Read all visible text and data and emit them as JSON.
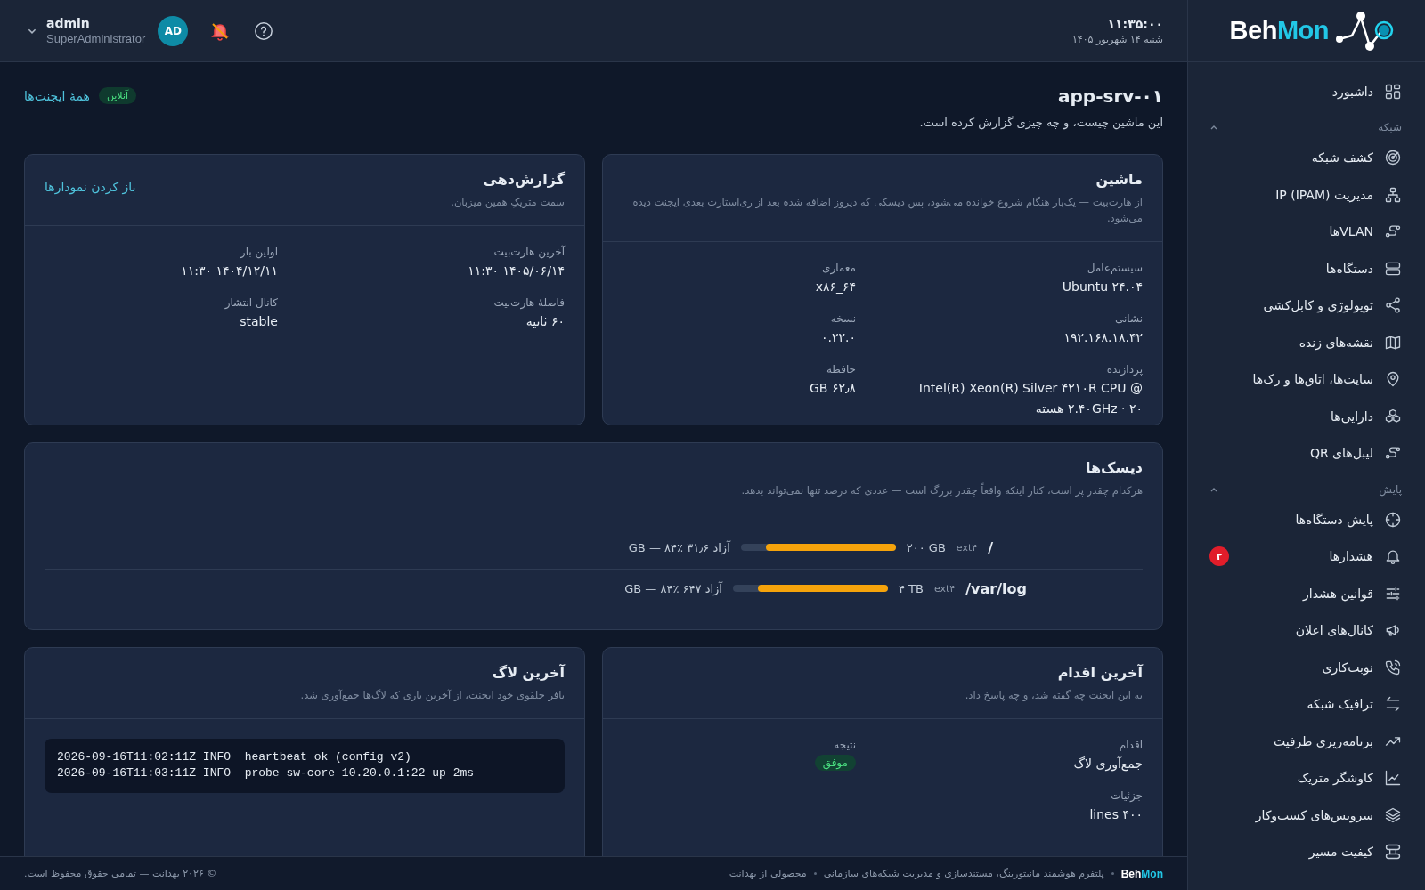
{
  "brand": {
    "part_1": "Beh",
    "part_2": "Mon"
  },
  "clock": {
    "time": "۱۱:۳۵:۰۰",
    "date": "شنبه ۱۴ شهریور ۱۴۰۵"
  },
  "user": {
    "name": "admin",
    "role": "SuperAdministrator",
    "initials": "AD"
  },
  "sidebar": {
    "items": [
      {
        "label": "داشبورد",
        "selected": false
      }
    ],
    "groups": [
      {
        "title": "شبکه",
        "expanded": true,
        "items": [
          {
            "label": "کشف شبکه",
            "selected": false
          },
          {
            "label": "مدیریت IP (IPAM)",
            "selected": false
          },
          {
            "label": "VLANها",
            "selected": false
          },
          {
            "label": "دستگاه‌ها",
            "selected": false
          },
          {
            "label": "توپولوژی و کابل‌کشی",
            "selected": false
          },
          {
            "label": "نقشه‌های زنده",
            "selected": false
          },
          {
            "label": "سایت‌ها، اتاق‌ها و رک‌ها",
            "selected": false
          },
          {
            "label": "دارایی‌ها",
            "selected": false
          },
          {
            "label": "لیبل‌های QR",
            "selected": false
          }
        ]
      },
      {
        "title": "پایش",
        "expanded": true,
        "items": [
          {
            "label": "پایش دستگاه‌ها",
            "selected": false
          },
          {
            "label": "هشدارها",
            "selected": false,
            "badge": "۲"
          },
          {
            "label": "قوانین هشدار",
            "selected": false
          },
          {
            "label": "کانال‌های اعلان",
            "selected": false
          },
          {
            "label": "نوبت‌کاری",
            "selected": false
          },
          {
            "label": "ترافیک شبکه",
            "selected": false
          },
          {
            "label": "برنامه‌ریزی ظرفیت",
            "selected": false
          },
          {
            "label": "کاوشگر متریک",
            "selected": false
          },
          {
            "label": "سرویس‌های کسب‌وکار",
            "selected": false
          },
          {
            "label": "کیفیت مسیر",
            "selected": false
          }
        ]
      }
    ]
  },
  "page": {
    "title": "app-srv-۰۱",
    "subtitle": "این ماشین چیست، و چه چیزی گزارش کرده است.",
    "status": "آنلاین",
    "back_link": "همهٔ ایجنت‌ها"
  },
  "machine": {
    "title": "ماشین",
    "subtitle": "از هارت‌بیت — یک‌بار هنگام شروع خوانده می‌شود، پس دیسکی که دیروز اضافه شده بعد از ری‌استارت بعدی ایجنت دیده می‌شود.",
    "fields": [
      {
        "label": "سیستم‌عامل",
        "value": "Ubuntu ۲۴.۰۴"
      },
      {
        "label": "معماری",
        "value": "x۸۶_۶۴"
      },
      {
        "label": "نشانی",
        "value": "۱۹۲.۱۶۸.۱۸.۴۲"
      },
      {
        "label": "نسخه",
        "value": "۰.۲۲.۰"
      },
      {
        "label": "پردازنده",
        "value": "Intel(R) Xeon(R) Silver ۴۲۱۰R CPU @ ۲.۴۰GHz · ۲۰ هسته"
      },
      {
        "label": "حافظه",
        "value": "۶۲٫۸ GB"
      }
    ]
  },
  "reporting": {
    "title": "گزارش‌دهی",
    "subtitle": "سمت متریکِ همین میزبان.",
    "link": "باز کردن نمودارها",
    "fields": [
      {
        "label": "آخرین هارت‌بیت",
        "value": "۱۴۰۵/۰۶/۱۴ ۱۱:۳۰"
      },
      {
        "label": "اولین بار",
        "value": "۱۴۰۴/۱۲/۱۱ ۱۱:۳۰"
      },
      {
        "label": "فاصلهٔ هارت‌بیت",
        "value": "۶۰ ثانیه"
      },
      {
        "label": "کانال انتشار",
        "value": "stable"
      }
    ]
  },
  "disks": {
    "title": "دیسک‌ها",
    "subtitle": "هرکدام چقدر پر است، کنار اینکه واقعاً چقدر بزرگ است — عددی که درصد تنها نمی‌تواند بدهد.",
    "rows": [
      {
        "mount": "/",
        "fs": "ext۴",
        "size": "۲۰۰ GB",
        "level": 0.84,
        "free": "آزاد ۳۱٫۶ GB — ۸۴٪"
      },
      {
        "mount": "/var/log",
        "fs": "ext۴",
        "size": "۴ TB",
        "level": 0.84,
        "free": "آزاد ۶۴۷ GB — ۸۴٪"
      }
    ]
  },
  "last_action": {
    "title": "آخرین اقدام",
    "subtitle": "به این ایجنت چه گفته شد، و چه پاسخ داد.",
    "fields": [
      {
        "label": "اقدام",
        "value": "جمع‌آوری لاگ",
        "kind": "text"
      },
      {
        "label": "نتیجه",
        "value": "موفق",
        "kind": "badge"
      },
      {
        "label": "جزئیات",
        "value": "۴۰۰ lines",
        "kind": "text"
      }
    ]
  },
  "last_log": {
    "title": "آخرین لاگ",
    "subtitle": "بافر حلقوی خود ایجنت، از آخرین باری که لاگ‌ها جمع‌آوری شد.",
    "lines": [
      "2026-09-16T11:02:11Z INFO  heartbeat ok (config v2)",
      "2026-09-16T11:03:11Z INFO  probe sw-core 10.20.0.1:22 up 2ms"
    ]
  },
  "footer": {
    "brand_1": "Beh",
    "brand_2": "Mon",
    "tagline": "پلتفرم هوشمند مانیتورینگ، مستندسازی و مدیریت شبکه‌های سازمانی",
    "maker": "محصولی از بهدانت",
    "copyright": "© ۲۰۲۶ بهدانت — تمامی حقوق محفوظ است."
  }
}
